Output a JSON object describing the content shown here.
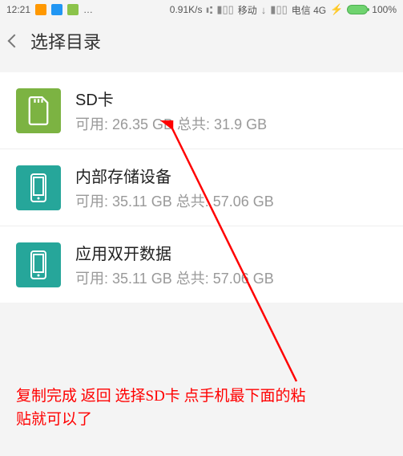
{
  "status": {
    "time": "12:21",
    "speed": "0.91K/s",
    "carrier1": "移动",
    "carrier2": "电信 4G",
    "battery": "100%"
  },
  "header": {
    "title": "选择目录"
  },
  "storage": [
    {
      "name": "SD卡",
      "sub": "可用: 26.35 GB 总共: 31.9 GB"
    },
    {
      "name": "内部存储设备",
      "sub": "可用: 35.11 GB 总共: 57.06 GB"
    },
    {
      "name": "应用双开数据",
      "sub": "可用: 35.11 GB 总共: 57.06 GB"
    }
  ],
  "annotation": {
    "line1": "复制完成  返回  选择SD卡   点手机最下面的粘",
    "line2": "贴就可以了"
  }
}
